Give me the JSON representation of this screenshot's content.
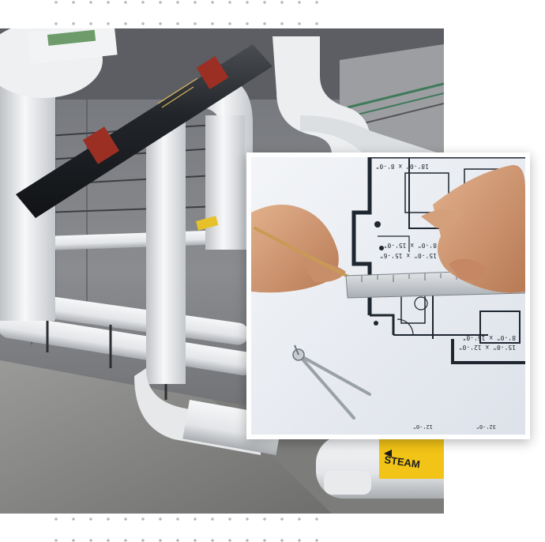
{
  "pipes_photo": {
    "pipe_label": "STEAM"
  },
  "blueprint_photo": {
    "plan_dimensions": [
      "18'-0\" x 8'-0\"",
      "8'-0\" x 15'-0\"",
      "15'-0\" x 15'-6\"",
      "8'-0\" x 15'-0\"",
      "15'-0\" x 12'-0\""
    ],
    "small_labels": [
      "32'-0\"",
      "12'-0\""
    ]
  }
}
